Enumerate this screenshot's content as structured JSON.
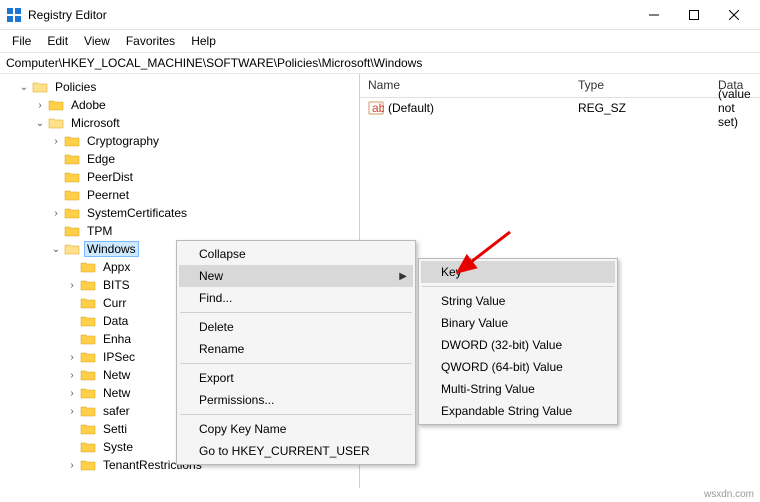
{
  "titlebar": {
    "title": "Registry Editor"
  },
  "menu": {
    "file": "File",
    "edit": "Edit",
    "view": "View",
    "favorites": "Favorites",
    "help": "Help"
  },
  "address": {
    "path": "Computer\\HKEY_LOCAL_MACHINE\\SOFTWARE\\Policies\\Microsoft\\Windows"
  },
  "tree": {
    "policies": "Policies",
    "adobe": "Adobe",
    "microsoft": "Microsoft",
    "cryptography": "Cryptography",
    "edge": "Edge",
    "peerdist": "PeerDist",
    "peernet": "Peernet",
    "systemcertificates": "SystemCertificates",
    "tpm": "TPM",
    "windows": "Windows",
    "appx": "Appx",
    "bits": "BITS",
    "curr": "Curr",
    "data": "Data",
    "enha": "Enha",
    "ipsec": "IPSec",
    "netw1": "Netw",
    "netw2": "Netw",
    "safer": "safer",
    "setti": "Setti",
    "syste": "Syste",
    "tenant": "TenantRestrictions"
  },
  "list": {
    "header_name": "Name",
    "header_type": "Type",
    "header_data": "Data",
    "row0_name": "(Default)",
    "row0_type": "REG_SZ",
    "row0_data": "(value not set)"
  },
  "context_primary": {
    "collapse": "Collapse",
    "new": "New",
    "find": "Find...",
    "delete": "Delete",
    "rename": "Rename",
    "export": "Export",
    "permissions": "Permissions...",
    "copy_key_name": "Copy Key Name",
    "goto_hkcu": "Go to HKEY_CURRENT_USER"
  },
  "context_new": {
    "key": "Key",
    "string": "String Value",
    "binary": "Binary Value",
    "dword": "DWORD (32-bit) Value",
    "qword": "QWORD (64-bit) Value",
    "multi": "Multi-String Value",
    "expand": "Expandable String Value"
  },
  "watermark": "wsxdn.com"
}
